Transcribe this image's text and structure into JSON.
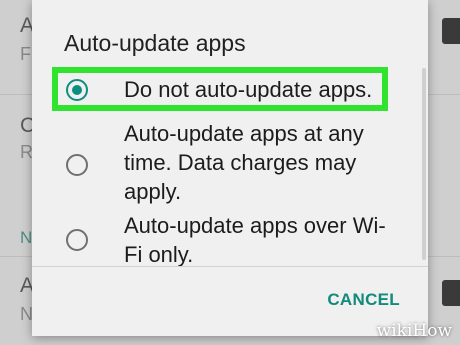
{
  "background": {
    "rows": [
      {
        "letter": "A",
        "sub": "F"
      },
      {
        "letter": "C",
        "sub": "R"
      },
      {
        "section": "N"
      },
      {
        "letter": "A",
        "sub": "N"
      }
    ]
  },
  "dialog": {
    "title": "Auto-update apps",
    "options": [
      {
        "label": "Do not auto-update apps.",
        "selected": true
      },
      {
        "label": "Auto-update apps at any time. Data charges may apply.",
        "selected": false
      },
      {
        "label": "Auto-update apps over Wi-Fi only.",
        "selected": false
      }
    ],
    "cancel_label": "CANCEL"
  },
  "colors": {
    "accent": "#0d8f80",
    "highlight": "#2fe32f",
    "dialog_bg": "#f0f0f0"
  },
  "watermark": "wikiHow"
}
